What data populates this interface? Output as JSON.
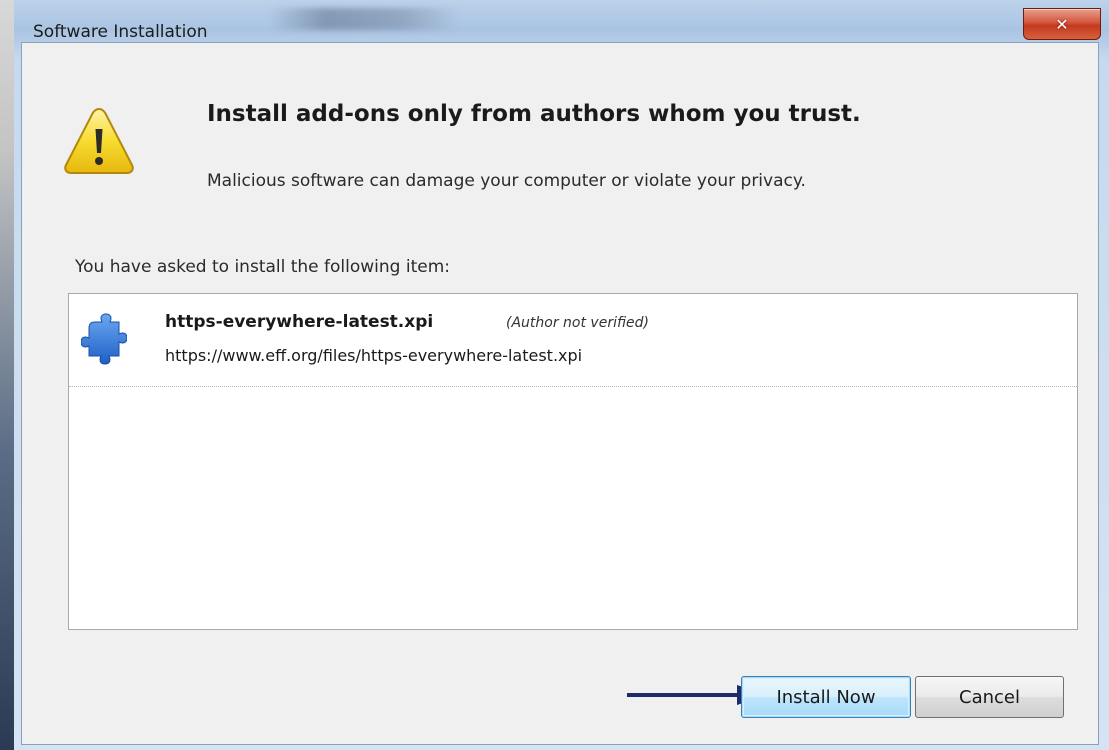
{
  "window": {
    "title": "Software Installation",
    "close_glyph": "✕"
  },
  "warning": {
    "icon": "warning-icon",
    "headline": "Install add-ons only from authors whom you trust.",
    "subline": "Malicious software can damage your computer or violate your privacy."
  },
  "items_label": "You have asked to install the following item:",
  "items": [
    {
      "icon": "puzzle-piece-icon",
      "name": "https-everywhere-latest.xpi",
      "author_note": "(Author not verified)",
      "url": "https://www.eff.org/files/https-everywhere-latest.xpi"
    }
  ],
  "buttons": {
    "install": "Install Now",
    "cancel": "Cancel"
  },
  "annotation": {
    "icon": "arrow-right-icon",
    "color": "#1f2a6b"
  },
  "colors": {
    "close_button": "#c23a1e",
    "window_frame": "#a9c4e2",
    "warning_yellow": "#f5d426",
    "puzzle_blue": "#2f6fd1"
  }
}
